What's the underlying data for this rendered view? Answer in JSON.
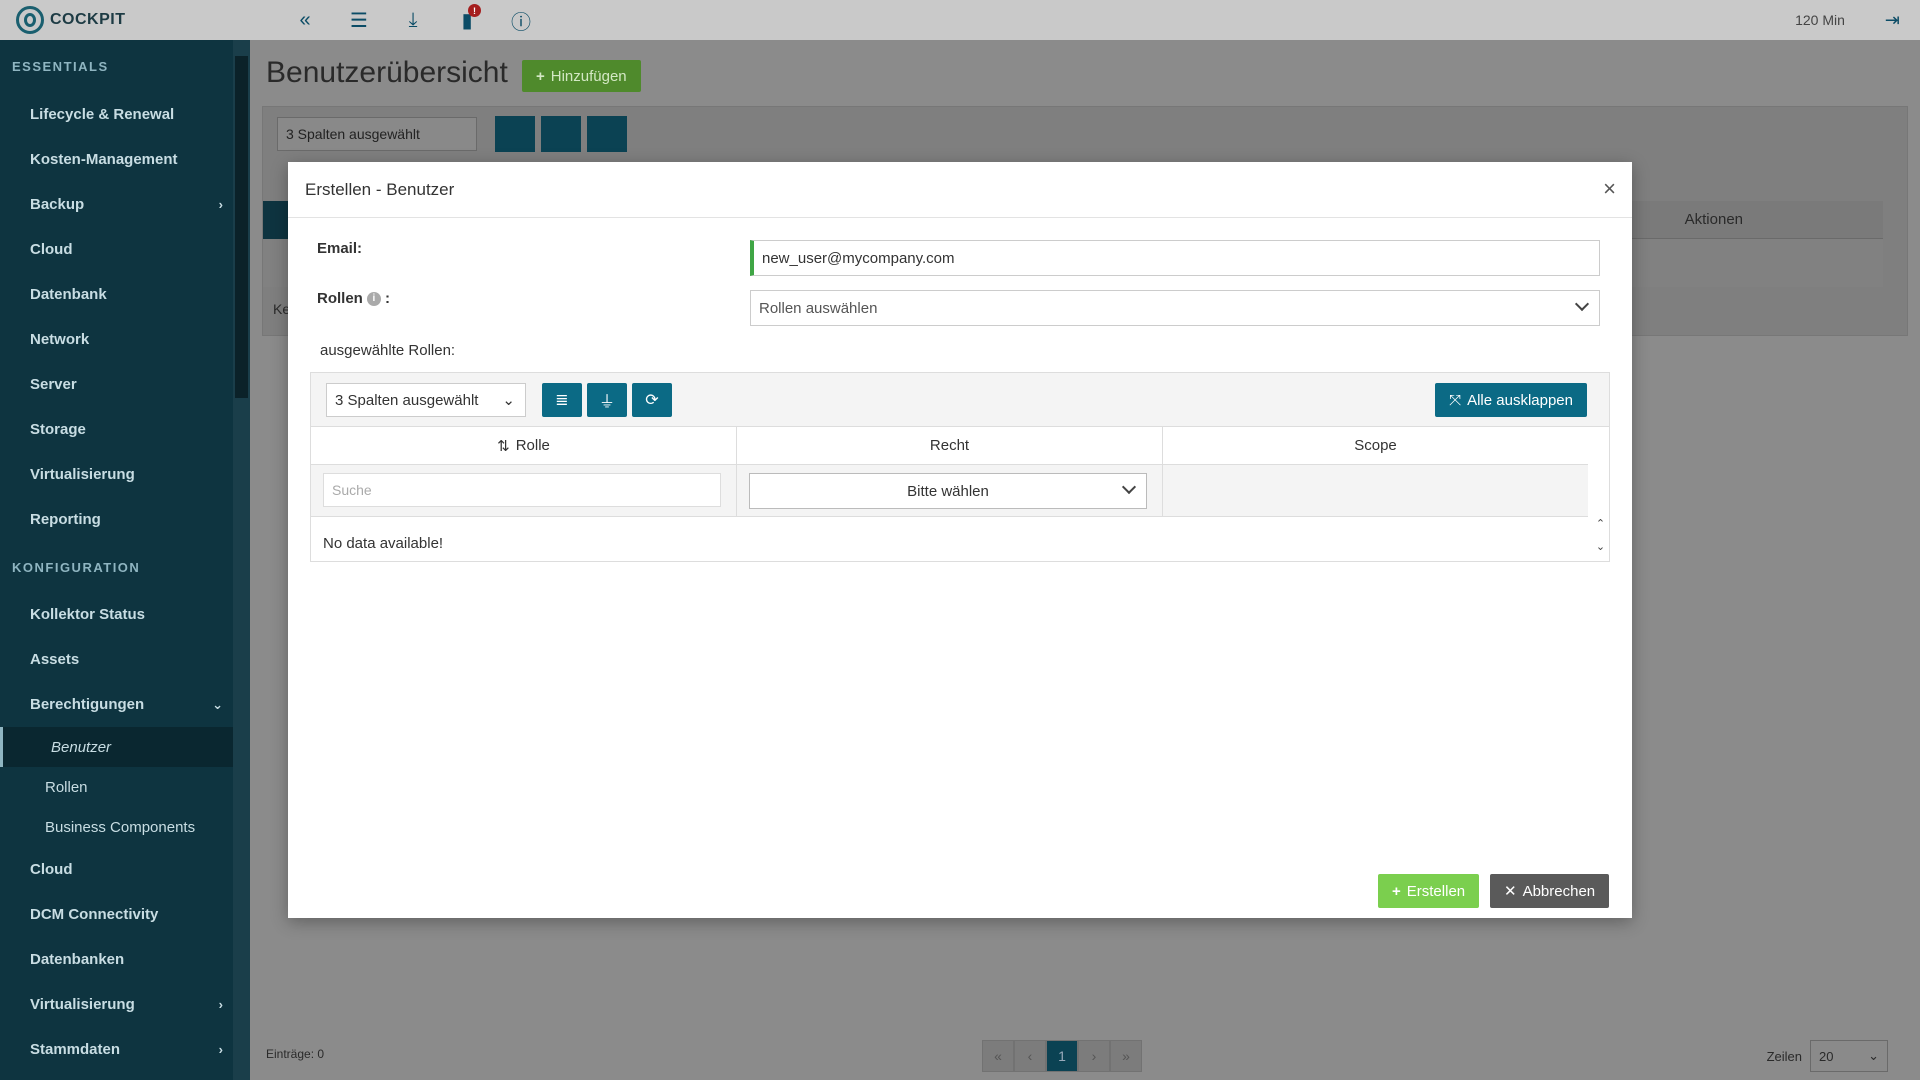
{
  "topbar": {
    "app_name": "COCKPIT",
    "badge_count": "!",
    "timer": "120 Min",
    "icons": [
      "double-chevron-left-icon",
      "sliders-icon",
      "download-icon",
      "notes-icon",
      "info-icon",
      "logout-icon"
    ]
  },
  "sidebar": {
    "section_essentials": "ESSENTIALS",
    "essentials": [
      "Lifecycle & Renewal",
      "Kosten-Management",
      "Backup",
      "Cloud",
      "Datenbank",
      "Network",
      "Server",
      "Storage",
      "Virtualisierung",
      "Reporting"
    ],
    "section_konfiguration": "KONFIGURATION",
    "konfiguration": [
      "Kollektor Status",
      "Assets",
      "Berechtigungen"
    ],
    "berechtigungen_subs": [
      "Benutzer",
      "Rollen",
      "Business Components"
    ],
    "after_subs": [
      "Cloud",
      "DCM Connectivity",
      "Datenbanken",
      "Virtualisierung",
      "Stammdaten"
    ],
    "active_item": "Benutzer"
  },
  "main": {
    "title": "Benutzerübersicht",
    "add_button": "Hinzufügen",
    "columns_select": "3 Spalten ausgewählt",
    "header_aktionen": "Aktionen",
    "row_text": "Ke",
    "entries": "Einträge: 0",
    "page_current": "1",
    "rows_label": "Zeilen",
    "rows_value": "20"
  },
  "modal": {
    "title": "Erstellen - Benutzer",
    "email_label": "Email:",
    "email_value": "new_user@mycompany.com",
    "roles_label": "Rollen",
    "roles_colon": ":",
    "roles_placeholder": "Rollen auswählen",
    "selected_roles_label": "ausgewählte Rollen:",
    "columns_select": "3 Spalten ausgewählt",
    "expand_all": "Alle ausklappen",
    "col_role": "Rolle",
    "col_right": "Recht",
    "col_scope": "Scope",
    "search_placeholder": "Suche",
    "right_select": "Bitte wählen",
    "no_data": "No data available!",
    "create_button": "Erstellen",
    "cancel_button": "Abbrechen"
  },
  "colors": {
    "sidebar_bg": "#0e3440",
    "accent": "#0b6a85",
    "success": "#7bcf4e",
    "input_valid": "#3fa645"
  }
}
